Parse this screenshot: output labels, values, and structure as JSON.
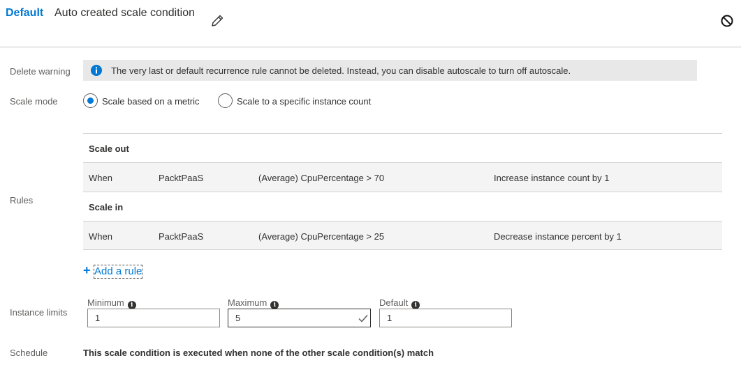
{
  "header": {
    "badge": "Default",
    "condition_name": "Auto created scale condition",
    "edit_icon": "pencil-icon",
    "disable_icon": "circle-slash-icon"
  },
  "delete_warning": {
    "label": "Delete warning",
    "icon": "info-icon",
    "text": "The very last or default recurrence rule cannot be deleted. Instead, you can disable autoscale to turn off autoscale."
  },
  "scale_mode": {
    "label": "Scale mode",
    "options": [
      {
        "label": "Scale based on a metric",
        "selected": true
      },
      {
        "label": "Scale to a specific instance count",
        "selected": false
      }
    ]
  },
  "rules": {
    "label": "Rules",
    "groups": [
      {
        "title": "Scale out",
        "rows": [
          {
            "when": "When",
            "resource": "PacktPaaS",
            "condition": "(Average) CpuPercentage > 70",
            "action": "Increase instance count by 1"
          }
        ]
      },
      {
        "title": "Scale in",
        "rows": [
          {
            "when": "When",
            "resource": "PacktPaaS",
            "condition": "(Average) CpuPercentage > 25",
            "action": "Decrease instance percent by 1"
          }
        ]
      }
    ],
    "add_rule": "Add a rule"
  },
  "instance_limits": {
    "label": "Instance limits",
    "minimum": {
      "label": "Minimum",
      "value": "1"
    },
    "maximum": {
      "label": "Maximum",
      "value": "5"
    },
    "default": {
      "label": "Default",
      "value": "1"
    }
  },
  "schedule": {
    "label": "Schedule",
    "text": "This scale condition is executed when none of the other scale condition(s) match"
  },
  "colors": {
    "accent": "#0078d4",
    "warning_bg": "#e8e8e8",
    "rule_row_bg": "#f4f4f4"
  }
}
